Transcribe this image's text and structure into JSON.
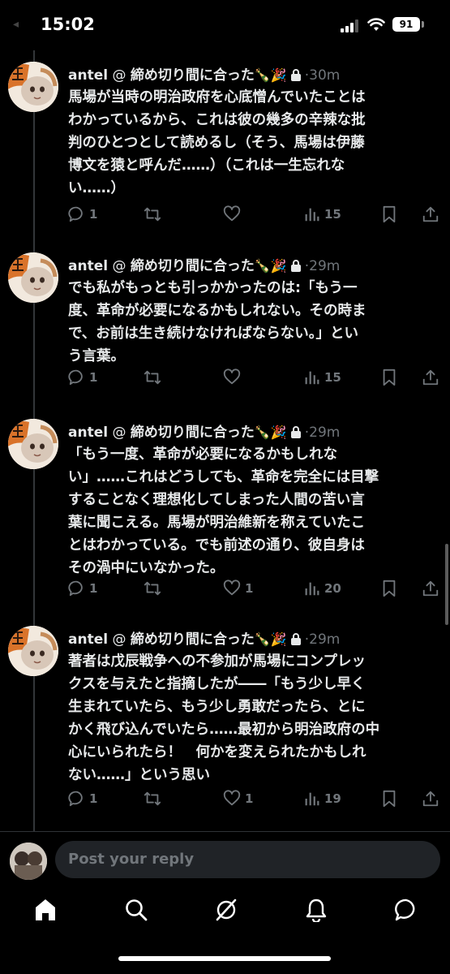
{
  "status_bar": {
    "time": "15:02",
    "battery": "91"
  },
  "tweets": [
    {
      "name": "antel",
      "handle_prefix": "@",
      "display_suffix": "締め切り間に合った",
      "emoji": "🍾🎉",
      "dot": "·",
      "time": "30m",
      "lines": [
        "馬場が当時の明治政府を心底憎んでいたことは",
        "わかっているから、これは彼の幾多の辛辣な批",
        "判のひとつとして読めるし（そう、馬場は伊藤",
        "博文を猿と呼んだ……）（これは一生忘れな",
        "い……）"
      ],
      "replies": "1",
      "reposts": "",
      "likes": "",
      "views": "15"
    },
    {
      "name": "antel",
      "handle_prefix": "@",
      "display_suffix": "締め切り間に合った",
      "emoji": "🍾🎉",
      "dot": "·",
      "time": "29m",
      "lines": [
        "でも私がもっとも引っかかったのは:「もう一",
        "度、革命が必要になるかもしれない。その時ま",
        "で、お前は生き続けなければならない。」とい",
        "う言葉。"
      ],
      "replies": "1",
      "reposts": "",
      "likes": "",
      "views": "15"
    },
    {
      "name": "antel",
      "handle_prefix": "@",
      "display_suffix": "締め切り間に合った",
      "emoji": "🍾🎉",
      "dot": "·",
      "time": "29m",
      "lines": [
        "「もう一度、革命が必要になるかもしれな",
        "い」……これはどうしても、革命を完全には目撃",
        "することなく理想化してしまった人間の苦い言",
        "葉に聞こえる。馬場が明治維新を称えていたこ",
        "とはわかっている。でも前述の通り、彼自身は",
        "その渦中にいなかった。"
      ],
      "replies": "1",
      "reposts": "",
      "likes": "1",
      "views": "20"
    },
    {
      "name": "antel",
      "handle_prefix": "@",
      "display_suffix": "締め切り間に合った",
      "emoji": "🍾🎉",
      "dot": "·",
      "time": "29m",
      "lines": [
        "著者は戊辰戦争への不参加が馬場にコンプレッ",
        "クスを与えたと指摘したが――「もう少し早く",
        "生まれていたら、もう少し勇敢だったら、とに",
        "かく飛び込んでいたら……最初から明治政府の中",
        "心にいられたら！　何かを変えられたかもしれ",
        "ない……」という思い"
      ],
      "replies": "1",
      "reposts": "",
      "likes": "1",
      "views": "19"
    }
  ],
  "reply_box": {
    "placeholder": "Post your reply"
  },
  "nav": {
    "items": [
      "home-icon",
      "search-icon",
      "grok-icon",
      "notifications-icon",
      "messages-icon"
    ]
  },
  "colors": {
    "background": "#000000",
    "text": "#e7e9ea",
    "muted": "#71767b",
    "divider": "#2f3336"
  }
}
